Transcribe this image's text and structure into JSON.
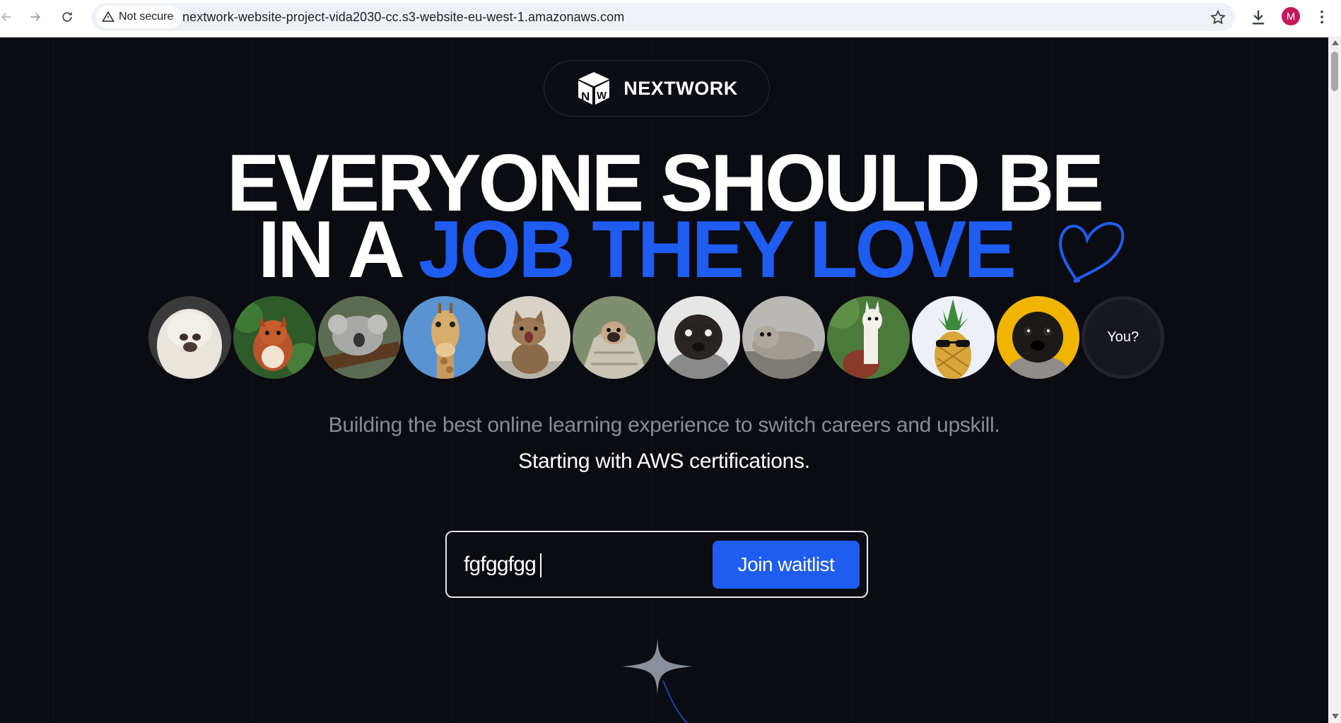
{
  "browser": {
    "back_icon": "arrow-left-icon",
    "forward_icon": "arrow-right-icon",
    "reload_icon": "reload-icon",
    "security_label": "Not secure",
    "security_icon": "warning-triangle-icon",
    "url": "nextwork-website-project-vida2030-cc.s3-website-eu-west-1.amazonaws.com",
    "bookmark_icon": "star-icon",
    "download_icon": "download-icon",
    "profile_initial": "M",
    "profile_color": "#c2185b",
    "menu_icon": "kebab-menu-icon"
  },
  "brand": {
    "name": "NEXTWORK",
    "logo_letters": "NW"
  },
  "hero": {
    "headline_line1": "EVERYONE SHOULD BE",
    "headline_line2_prefix": "IN A",
    "headline_line2_accent": "JOB THEY LOVE",
    "heart_icon": "heart-outline-icon",
    "accent_color": "#1f5cf2"
  },
  "avatars": {
    "items": [
      "sheep-dog",
      "squirrel",
      "koala",
      "giraffe",
      "kitten",
      "pug-blanket",
      "pug-glasses",
      "seal",
      "llama",
      "pineapple-sunglasses",
      "pug-yellow"
    ],
    "you_label": "You?"
  },
  "copy": {
    "tagline": "Building the best online learning experience to switch careers and upskill.",
    "subtagline": "Starting with AWS certifications."
  },
  "waitlist": {
    "input_value": "fgfggfgg",
    "button_label": "Join waitlist"
  },
  "decor": {
    "sparkle_icon": "sparkle-star-icon"
  }
}
